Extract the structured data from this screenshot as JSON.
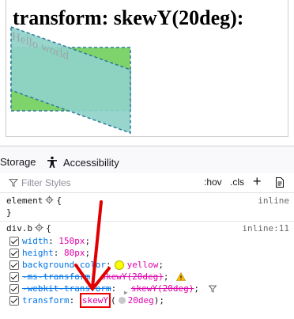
{
  "preview": {
    "heading": "transform: skewY(20deg):",
    "skewed_text": "Hello world"
  },
  "devtools": {
    "tabs": [
      {
        "label": "Storage"
      },
      {
        "label": "Accessibility"
      }
    ],
    "filter": {
      "placeholder": "Filter Styles",
      "hov": ":hov",
      "cls": ".cls",
      "add": "+"
    },
    "rules": [
      {
        "selector": "element",
        "source": "inline",
        "open": "{",
        "close": "}"
      },
      {
        "selector": "div.b",
        "source": "inline:11",
        "open": "{",
        "declarations": [
          {
            "name": "width",
            "value": "150px"
          },
          {
            "name": "height",
            "value": "80px"
          },
          {
            "name": "background-color",
            "value": "yellow"
          },
          {
            "name": "-ms-transform",
            "value": "skewY(20deg)"
          },
          {
            "name": "-webkit-transform",
            "value": "skewY(20deg)"
          },
          {
            "name": "transform",
            "value_fn": "skewY",
            "value_arg": "20deg"
          }
        ]
      }
    ],
    "colors": {
      "accent": "#0074e8",
      "value": "#dd00a9",
      "annotation": "#e00000"
    }
  }
}
